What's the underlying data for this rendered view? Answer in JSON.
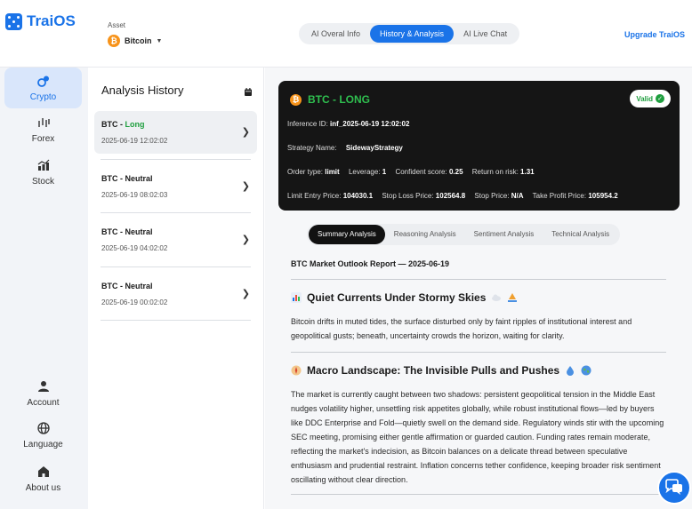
{
  "app": {
    "name": "TraiOS",
    "brand_color": "#1a73e8"
  },
  "asset": {
    "label": "Asset",
    "selected": "Bitcoin",
    "coin_symbol": "₿"
  },
  "top_tabs": [
    {
      "label": "AI Overal Info",
      "active": false
    },
    {
      "label": "History & Analysis",
      "active": true
    },
    {
      "label": "AI Live Chat",
      "active": false
    }
  ],
  "upgrade_label": "Upgrade TraiOS",
  "sidenav": {
    "top": [
      {
        "label": "Crypto",
        "icon": "coins-icon",
        "active": true
      },
      {
        "label": "Forex",
        "icon": "forex-icon",
        "active": false
      },
      {
        "label": "Stock",
        "icon": "stock-chart-icon",
        "active": false
      }
    ],
    "bottom": [
      {
        "label": "Account",
        "icon": "user-icon"
      },
      {
        "label": "Language",
        "icon": "globe-icon"
      },
      {
        "label": "About us",
        "icon": "home-icon"
      }
    ]
  },
  "history": {
    "title": "Analysis History",
    "items": [
      {
        "asset": "BTC - ",
        "signal": "Long",
        "date": "2025-06-19 12:02:02",
        "active": true
      },
      {
        "asset": "BTC - ",
        "signal": "Neutral",
        "date": "2025-06-19 08:02:03",
        "active": false
      },
      {
        "asset": "BTC - ",
        "signal": "Neutral",
        "date": "2025-06-19 04:02:02",
        "active": false
      },
      {
        "asset": "BTC - ",
        "signal": "Neutral",
        "date": "2025-06-19 00:02:02",
        "active": false
      }
    ]
  },
  "card": {
    "title": "BTC - LONG",
    "status": "Valid",
    "inference_label": "Inference ID:",
    "inference_id": "inf_2025-06-19 12:02:02",
    "strategy_label": "Strategy Name:",
    "strategy_name": "SidewayStrategy",
    "order_type_label": "Order type:",
    "order_type": "limit",
    "leverage_label": "Leverage:",
    "leverage": "1",
    "confident_label": "Confident score:",
    "confident": "0.25",
    "ror_label": "Return on risk:",
    "ror": "1.31",
    "entry_label": "Limit Entry Price:",
    "entry": "104030.1",
    "sl_label": "Stop Loss Price:",
    "sl": "102564.8",
    "stop_label": "Stop Price:",
    "stop": "N/A",
    "tp_label": "Take Profit Price:",
    "tp": "105954.2"
  },
  "sub_tabs": [
    {
      "label": "Summary Analysis",
      "active": true
    },
    {
      "label": "Reasoning Analysis",
      "active": false
    },
    {
      "label": "Sentiment Analysis",
      "active": false
    },
    {
      "label": "Technical Analysis",
      "active": false
    }
  ],
  "report": {
    "title": "BTC Market Outlook Report — 2025-06-19",
    "sections": [
      {
        "heading": "Quiet Currents Under Stormy Skies",
        "body": "Bitcoin drifts in muted tides, the surface disturbed only by faint ripples of institutional interest and geopolitical gusts; beneath, uncertainty crowds the horizon, waiting for clarity."
      },
      {
        "heading": "Macro Landscape: The Invisible Pulls and Pushes",
        "body": "The market is currently caught between two shadows: persistent geopolitical tension in the Middle East nudges volatility higher, unsettling risk appetites globally, while robust institutional flows—led by buyers like DDC Enterprise and Fold—quietly swell on the demand side. Regulatory winds stir with the upcoming SEC meeting, promising either gentle affirmation or guarded caution. Funding rates remain moderate, reflecting the market's indecision, as Bitcoin balances on a delicate thread between speculative enthusiasm and prudential restraint. Inflation concerns tether confidence, keeping broader risk sentiment oscillating without clear direction."
      }
    ]
  }
}
